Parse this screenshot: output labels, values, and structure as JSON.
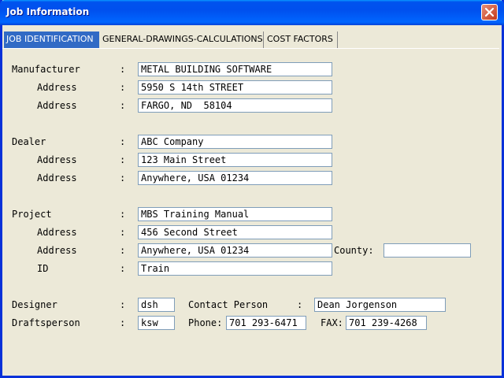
{
  "window": {
    "title": "Job Information"
  },
  "tabs": [
    {
      "label": "JOB IDENTIFICATION"
    },
    {
      "label": "GENERAL-DRAWINGS-CALCULATIONS"
    },
    {
      "label": "COST FACTORS"
    }
  ],
  "form": {
    "colon": ":",
    "manufacturer": {
      "label": "Manufacturer",
      "value": "METAL BUILDING SOFTWARE"
    },
    "manufacturer_address1": {
      "label": "Address",
      "value": "5950 S 14th STREET"
    },
    "manufacturer_address2": {
      "label": "Address",
      "value": "FARGO, ND  58104"
    },
    "dealer": {
      "label": "Dealer",
      "value": "ABC Company"
    },
    "dealer_address1": {
      "label": "Address",
      "value": "123 Main Street"
    },
    "dealer_address2": {
      "label": "Address",
      "value": "Anywhere, USA 01234"
    },
    "project": {
      "label": "Project",
      "value": "MBS Training Manual"
    },
    "project_address1": {
      "label": "Address",
      "value": "456 Second Street"
    },
    "project_address2": {
      "label": "Address",
      "value": "Anywhere, USA 01234"
    },
    "county": {
      "label": "County:",
      "value": ""
    },
    "id": {
      "label": "ID",
      "value": "Train"
    },
    "designer": {
      "label": "Designer",
      "value": "dsh"
    },
    "contact_person": {
      "label": "Contact Person",
      "value": "Dean Jorgenson"
    },
    "draftsperson": {
      "label": "Draftsperson",
      "value": "ksw"
    },
    "phone": {
      "label": "Phone:",
      "value": "701 293-6471"
    },
    "fax": {
      "label": "FAX:",
      "value": "701 239-4268"
    }
  }
}
